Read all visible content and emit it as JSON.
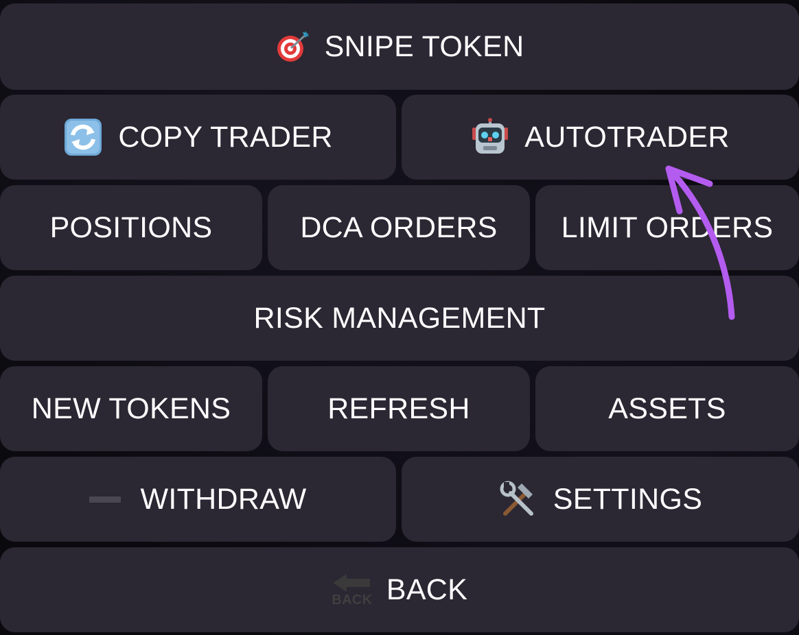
{
  "menu": {
    "snipe_token": {
      "label": "SNIPE TOKEN",
      "icon": "dart-target-icon"
    },
    "copy_trader": {
      "label": "COPY TRADER",
      "icon": "refresh-arrows-icon"
    },
    "autotrader": {
      "label": "AUTOTRADER",
      "icon": "robot-icon"
    },
    "positions": {
      "label": "POSITIONS"
    },
    "dca_orders": {
      "label": "DCA ORDERS"
    },
    "limit_orders": {
      "label": "LIMIT ORDERS"
    },
    "risk_management": {
      "label": "RISK MANAGEMENT"
    },
    "new_tokens": {
      "label": "NEW TOKENS"
    },
    "refresh": {
      "label": "REFRESH"
    },
    "assets": {
      "label": "ASSETS"
    },
    "withdraw": {
      "label": "WITHDRAW",
      "icon": "minus-icon"
    },
    "settings": {
      "label": "SETTINGS",
      "icon": "hammer-wrench-icon"
    },
    "back": {
      "label": "BACK",
      "icon": "back-arrow-icon",
      "icon_text": "BACK"
    }
  },
  "colors": {
    "button_bg": "#2b2733",
    "text": "#ffffff",
    "annotation_arrow": "#b45cf0"
  }
}
